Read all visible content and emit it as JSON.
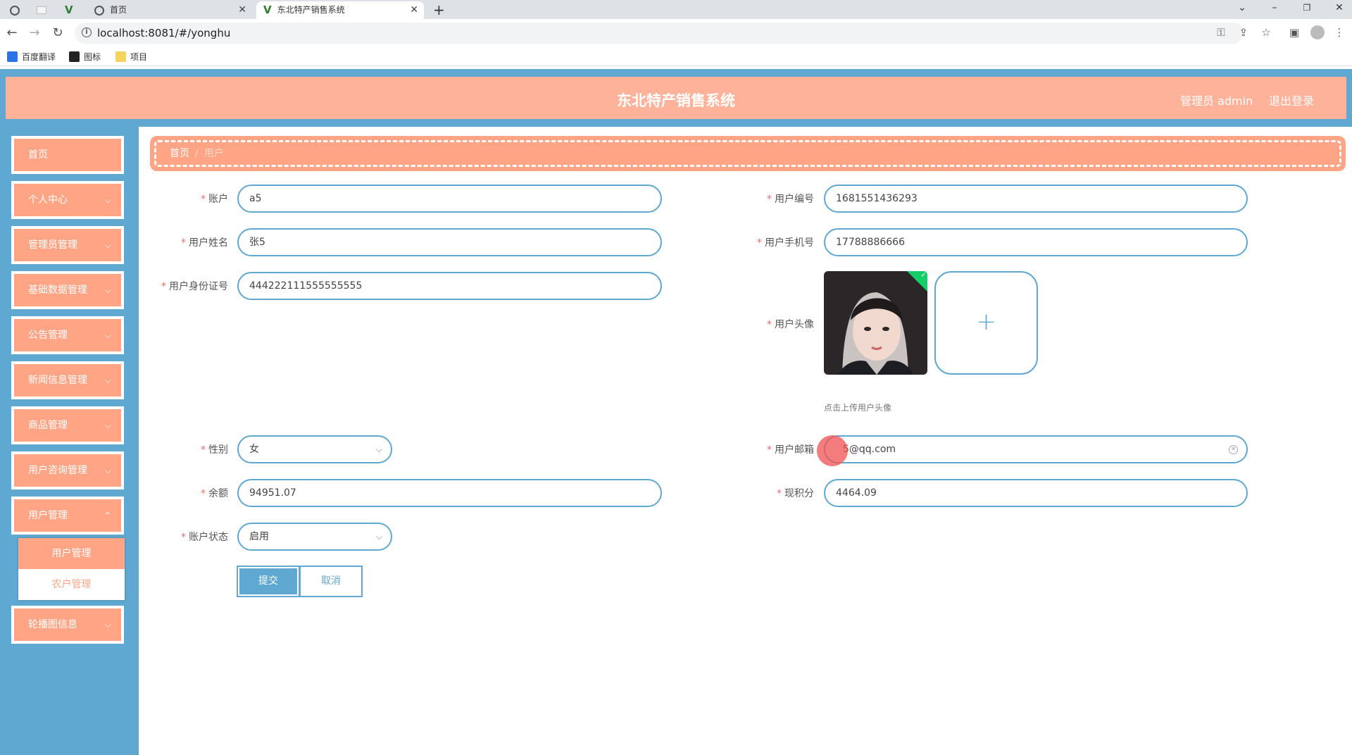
{
  "browser": {
    "tabs": [
      {
        "title": "",
        "icon": "globe-icon"
      },
      {
        "title": "",
        "icon": "page-icon"
      },
      {
        "title": "",
        "icon": "vue-icon"
      },
      {
        "title": "首页",
        "icon": "globe-icon"
      },
      {
        "title": "东北特产销售系统",
        "icon": "vue-icon"
      }
    ],
    "new_tab": "+",
    "url": "localhost:8081/#/yonghu",
    "bookmarks": [
      "百度翻译",
      "图标",
      "项目"
    ]
  },
  "header": {
    "title": "东北特产销售系统",
    "user": "管理员 admin",
    "logout": "退出登录"
  },
  "sidebar": {
    "items": [
      {
        "label": "首页"
      },
      {
        "label": "个人中心"
      },
      {
        "label": "管理员管理"
      },
      {
        "label": "基础数据管理"
      },
      {
        "label": "公告管理"
      },
      {
        "label": "新闻信息管理"
      },
      {
        "label": "商品管理"
      },
      {
        "label": "用户咨询管理"
      },
      {
        "label": "用户管理"
      },
      {
        "label": "轮播图信息"
      }
    ],
    "submenu": [
      "用户管理",
      "农户管理"
    ]
  },
  "breadcrumb": {
    "home": "首页",
    "sep": "/",
    "current": "用户"
  },
  "form": {
    "account": {
      "label": "账户",
      "value": "a5"
    },
    "user_no": {
      "label": "用户编号",
      "value": "1681551436293"
    },
    "user_name": {
      "label": "用户姓名",
      "value": "张5"
    },
    "phone": {
      "label": "用户手机号",
      "value": "17788886666"
    },
    "id_card": {
      "label": "用户身份证号",
      "value": "444222111555555555"
    },
    "avatar": {
      "label": "用户头像",
      "tip": "点击上传用户头像",
      "plus": "+"
    },
    "gender": {
      "label": "性别",
      "value": "女"
    },
    "email": {
      "label": "用户邮箱",
      "value": "5@qq.com"
    },
    "balance": {
      "label": "余额",
      "value": "94951.07"
    },
    "points": {
      "label": "现积分",
      "value": "4464.09"
    },
    "status": {
      "label": "账户状态",
      "value": "启用"
    },
    "submit": "提交",
    "cancel": "取消"
  },
  "colors": {
    "primary": "#5fa8d1",
    "accent": "#ffa586",
    "header": "#ffb29a"
  }
}
